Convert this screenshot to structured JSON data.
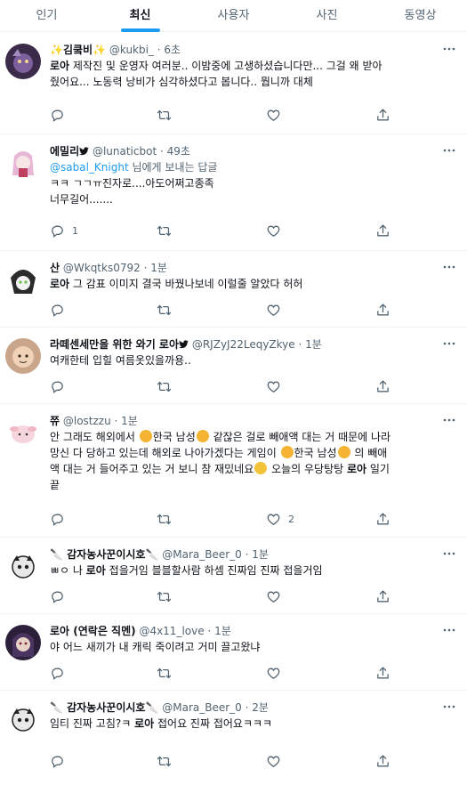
{
  "tabs": [
    {
      "label": "인기"
    },
    {
      "label": "최신"
    },
    {
      "label": "사용자"
    },
    {
      "label": "사진"
    },
    {
      "label": "동영상"
    }
  ],
  "colors": {
    "accent": "#1d9bf0",
    "text": "#0f1419",
    "muted": "#536471",
    "divider": "#eff3f4"
  },
  "icons": {
    "reply": "reply-icon",
    "retweet": "retweet-icon",
    "like": "heart-icon",
    "share": "share-icon",
    "more": "more-icon",
    "verified": "verified-icon"
  },
  "tweets": [
    {
      "name_prefix": "✨",
      "name": "김쿸비",
      "name_suffix": "✨",
      "handle": "@kukbi_",
      "time": "6초",
      "line1_pre": "",
      "line1_bold": "로아",
      "line1_post": " 제작진 및 운영자 여러분.. 이밤중에 고생하셨습니다만... 그걸 왜 받아",
      "line2": "줬어요... 노동력 낭비가 심각하셨다고 봅니다.. 뭡니까 대체",
      "reply_count": "",
      "retweet_count": "",
      "like_count": ""
    },
    {
      "name": "에밀리",
      "handle": "@lunaticbot",
      "time": "49초",
      "reply_mention": "@sabal_Knight",
      "reply_suffix": " 님에게 보내는 답글",
      "line1": "ㅋㅋ ㄱㄱㅠ진자로....아도어쩌고종족",
      "line2": "너무길어.......",
      "reply_count": "1",
      "retweet_count": "",
      "like_count": ""
    },
    {
      "name": "산",
      "handle": "@Wkqtks0792",
      "time": "1분",
      "line1_bold": "로아",
      "line1_post": " 그 감표 이미지 결국 바꿨나보네 이럴줄 알았다 허허",
      "reply_count": "",
      "retweet_count": "",
      "like_count": ""
    },
    {
      "name": "라떼센세만을 위한 와기 로아",
      "handle": "@RJZyJ22LeqyZkye",
      "time": "1분",
      "line1": "여캐한테 입힐 여름옷있을까용..",
      "reply_count": "",
      "retweet_count": "",
      "like_count": ""
    },
    {
      "name": "쮸",
      "handle": "@lostzzu",
      "time": "1분",
      "l1_a": "안 그래도 해외에서 ",
      "l1_b": "한국 남성",
      "l1_c": " 같잖은 걸로 빼애액 대는 거 때문에 나라",
      "l2_a": "망신 다 당하고 있는데 해외로 나아가겠다는 게임이 ",
      "l2_b": "한국 남성",
      "l2_c": " 의 빼애",
      "l3_a": "액 대는 거 들어주고 있는 거 보니 참 재밌네요",
      "l3_b": " 오늘의 우당탕탕 ",
      "l3_bold": "로아",
      "l3_c": " 일기",
      "l4": "끝",
      "reply_count": "",
      "retweet_count": "",
      "like_count": "2"
    },
    {
      "name_prefix": "🔪",
      "name": " 감자농사꾼이시호",
      "name_suffix": "🔪",
      "handle": "@Mara_Beer_0",
      "time": "1분",
      "line1_pre": "ㅃㅇ 나 ",
      "line1_bold": "로아",
      "line1_post": " 접을거임 블블할사람 하셈 진짜임 진짜 접을거임",
      "reply_count": "",
      "retweet_count": "",
      "like_count": ""
    },
    {
      "name": "로아 (연락은 직멘)",
      "handle": "@4x11_love",
      "time": "1분",
      "line1": "야 어느 새끼가 내 캐릭 죽이려고 거미 끌고왔냐",
      "reply_count": "",
      "retweet_count": "",
      "like_count": ""
    },
    {
      "name_prefix": "🔪",
      "name": " 감자농사꾼이시호",
      "name_suffix": "🔪",
      "handle": "@Mara_Beer_0",
      "time": "2분",
      "line1_pre": "임티 진짜 고침?ㅋ ",
      "line1_bold": "로아",
      "line1_post": " 접어요 진짜 접어요ㅋㅋㅋ",
      "reply_count": "",
      "retweet_count": "",
      "like_count": ""
    }
  ]
}
